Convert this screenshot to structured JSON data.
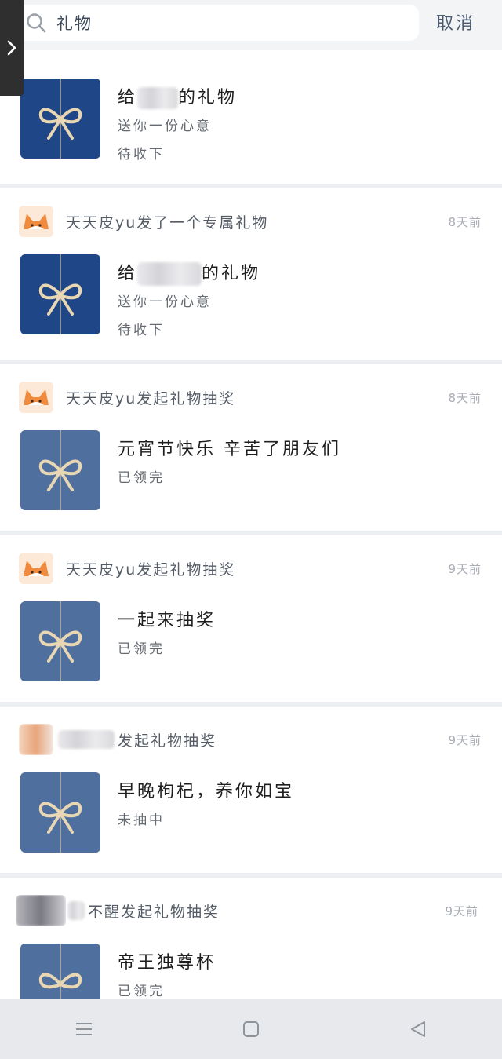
{
  "search": {
    "query": "礼物",
    "cancel_label": "取消"
  },
  "cards": [
    {
      "actor": "",
      "time": "",
      "thumb": "dark",
      "title_pre": "给",
      "title_post": "的礼物",
      "lines": [
        "送你一份心意",
        "待收下"
      ]
    },
    {
      "actor": "天天皮yu发了一个专属礼物",
      "time": "8天前",
      "thumb": "dark",
      "title_pre": "给",
      "title_post": "的礼物",
      "lines": [
        "送你一份心意",
        "待收下"
      ]
    },
    {
      "actor": "天天皮yu发起礼物抽奖",
      "time": "8天前",
      "thumb": "light",
      "title": "元宵节快乐 辛苦了朋友们",
      "lines": [
        "已领完"
      ]
    },
    {
      "actor": "天天皮yu发起礼物抽奖",
      "time": "9天前",
      "thumb": "light",
      "title": "一起来抽奖",
      "lines": [
        "已领完"
      ]
    },
    {
      "actor": "发起礼物抽奖",
      "time": "9天前",
      "thumb": "light",
      "title": "早晚枸杞，养你如宝",
      "lines": [
        "未抽中"
      ]
    },
    {
      "actor": "不醒发起礼物抽奖",
      "time": "9天前",
      "thumb": "light",
      "title": "帝王独尊杯",
      "lines": [
        "已领完"
      ]
    }
  ],
  "colors": {
    "thumb_dark": "#1f4787",
    "thumb_light": "#4f6f9f",
    "ribbon": "#e9d7b4",
    "page_bg": "#eceef1"
  },
  "icons": {
    "search": "search-icon",
    "side_handle": "chevron-right-icon",
    "gift_ribbon": "ribbon-bow-icon",
    "nav_menu": "menu-icon",
    "nav_home": "home-square-icon",
    "nav_back": "back-triangle-icon"
  }
}
